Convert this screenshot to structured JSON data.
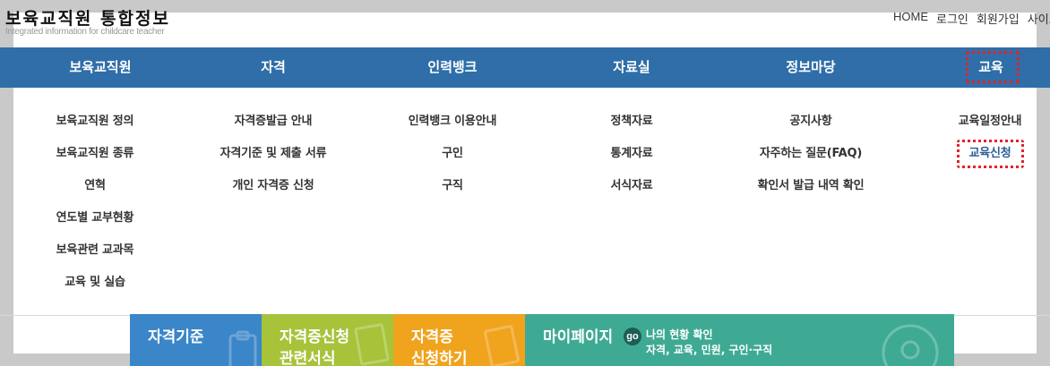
{
  "site": {
    "title": "보육교직원 통합정보",
    "subtitle": "Integrated information for childcare teacher"
  },
  "util_links": [
    "HOME",
    "로그인",
    "회원가입",
    "사이트맵"
  ],
  "nav": [
    "보육교직원",
    "자격",
    "인력뱅크",
    "자료실",
    "정보마당",
    "교육"
  ],
  "submenu": {
    "col0": [
      "보육교직원 정의",
      "보육교직원 종류",
      "연혁",
      "연도별 교부현황",
      "보육관련 교과목",
      "교육 및 실습"
    ],
    "col1": [
      "자격증발급 안내",
      "자격기준 및 제출 서류",
      "개인 자격증 신청"
    ],
    "col2": [
      "인력뱅크 이용안내",
      "구인",
      "구직"
    ],
    "col3": [
      "정책자료",
      "통계자료",
      "서식자료"
    ],
    "col4": [
      "공지사항",
      "자주하는 질문(FAQ)",
      "확인서 발급 내역 확인"
    ],
    "col5": [
      "교육일정안내",
      "교육신청"
    ]
  },
  "banners": {
    "b1": "자격기준",
    "b2_line1": "자격증신청",
    "b2_line2": "관련서식",
    "b3_line1": "자격증",
    "b3_line2": "신청하기",
    "b4_title": "마이페이지",
    "b4_go": "go",
    "b4_status": "나의 현황 확인",
    "b4_detail": "자격, 교육, 민원, 구인·구직"
  },
  "colors": {
    "nav_bg": "#2f6ea8",
    "highlight": "#e0242a",
    "banner1": "#3a86c8",
    "banner2": "#a6c33a",
    "banner3": "#f0a31c",
    "banner4": "#3faa93"
  }
}
